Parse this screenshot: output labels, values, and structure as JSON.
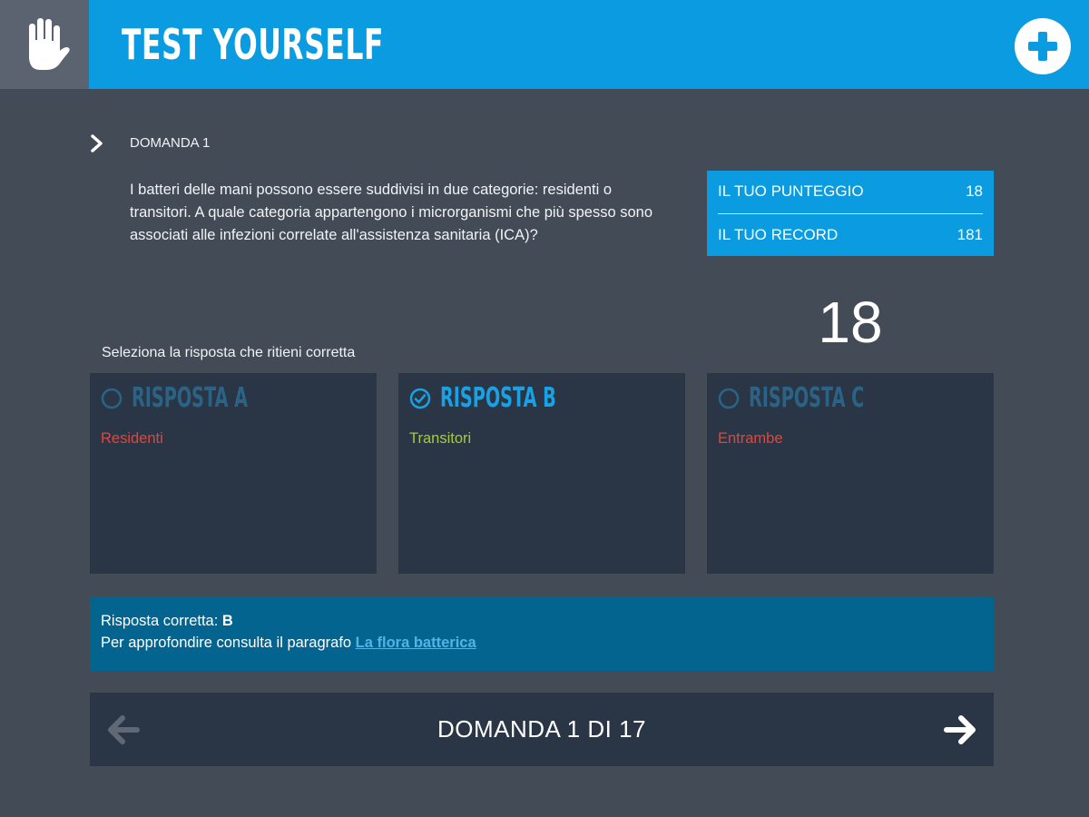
{
  "header": {
    "title": "TEST YOURSELF",
    "logo_icon": "hand-icon",
    "add_icon": "plus-circle-icon",
    "color": "#0a9be0"
  },
  "question": {
    "label": "DOMANDA 1",
    "text": "I batteri delle mani possono essere suddivisi in due categorie: residenti o transitori. A quale categoria appartengono i microrganismi che più spesso sono associati alle infezioni correlate all'assistenza sanitaria (ICA)?"
  },
  "score": {
    "score_label": "IL TUO PUNTEGGIO",
    "score_value": "18",
    "record_label": "IL TUO RECORD",
    "record_value": "181",
    "big_value": "18"
  },
  "answers": {
    "prompt": "Seleziona la risposta che ritieni corretta",
    "options": [
      {
        "title": "RISPOSTA A",
        "text": "Residenti",
        "selected": false,
        "color": "#e2453c"
      },
      {
        "title": "RISPOSTA B",
        "text": "Transitori",
        "selected": true,
        "color": "#a7c93d"
      },
      {
        "title": "RISPOSTA C",
        "text": "Entrambe",
        "selected": false,
        "color": "#e2453c"
      }
    ]
  },
  "feedback": {
    "correct_label": "Risposta corretta: ",
    "correct_value": "B",
    "more_label": "Per approfondire consulta il paragrafo ",
    "link_text": "La flora batterica"
  },
  "navigation": {
    "counter": "DOMANDA 1 DI 17",
    "prev_icon": "arrow-left-icon",
    "next_icon": "arrow-right-icon"
  }
}
